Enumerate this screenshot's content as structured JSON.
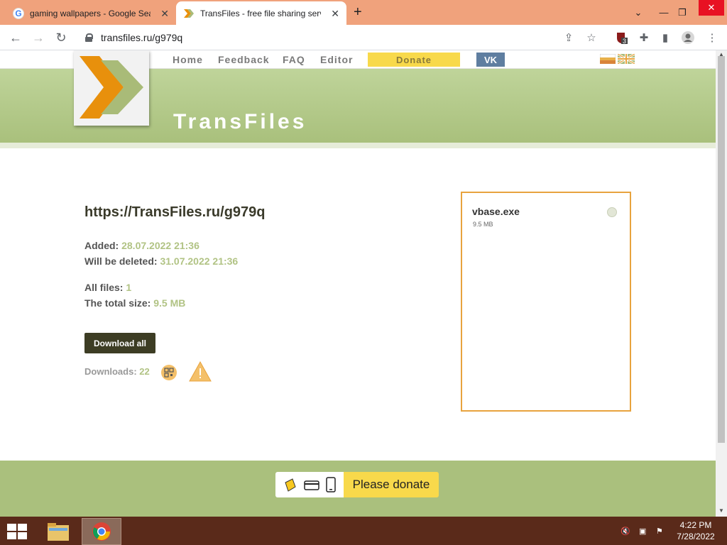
{
  "browser": {
    "tabs": [
      {
        "title": "gaming wallpapers - Google Sea",
        "active": false
      },
      {
        "title": "TransFiles - free file sharing servi",
        "active": true
      }
    ],
    "url": "transfiles.ru/g979q",
    "extension_badge": "3"
  },
  "site": {
    "nav": {
      "home": "Home",
      "feedback": "Feedback",
      "faq": "FAQ",
      "editor": "Editor",
      "donate": "Donate",
      "vk": "VK"
    },
    "title": "TransFiles",
    "file_url": "https://TransFiles.ru/g979q",
    "added_label": "Added:",
    "added_value": "28.07.2022 21:36",
    "deleted_label": "Will be deleted:",
    "deleted_value": "31.07.2022 21:36",
    "all_files_label": "All files:",
    "all_files_value": "1",
    "total_size_label": "The total size:",
    "total_size_value": "9.5 MB",
    "download_all": "Download all",
    "downloads_label": "Downloads:",
    "downloads_value": "22",
    "files": [
      {
        "name": "vbase.exe",
        "size": "9.5 MB"
      }
    ],
    "please_donate": "Please donate",
    "colors": {
      "banner": "#aac07d",
      "accent": "#e8a33e",
      "donate": "#f8d94b"
    }
  },
  "taskbar": {
    "time": "4:22 PM",
    "date": "7/28/2022"
  }
}
